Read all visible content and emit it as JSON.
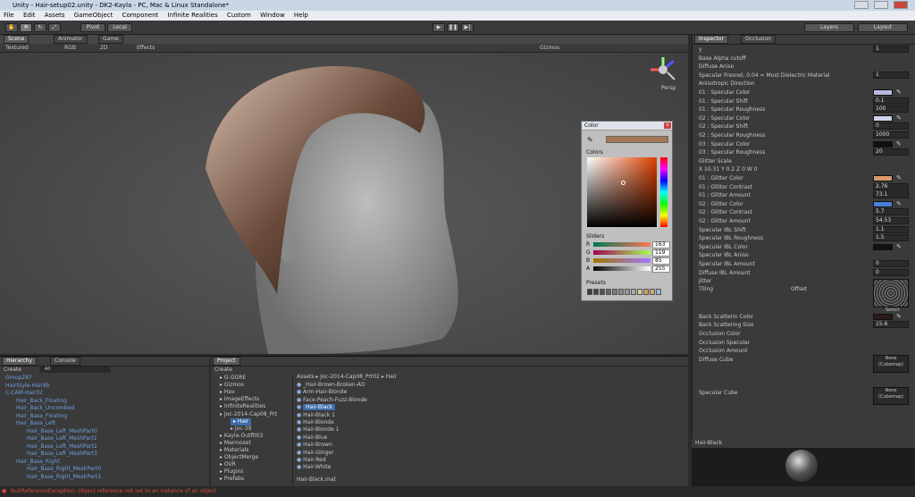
{
  "window": {
    "title": "Unity - Hair-setup02.unity - DK2-Kayla - PC, Mac & Linux Standalone*"
  },
  "menu": [
    "File",
    "Edit",
    "Assets",
    "GameObject",
    "Component",
    "Infinite Realities",
    "Custom",
    "Window",
    "Help"
  ],
  "toolbar": {
    "pivot": "Pivot",
    "local": "Local",
    "layers": "Layers",
    "layout": "Layout"
  },
  "tabs": {
    "scene": "Scene",
    "animator": "Animator",
    "game": "Game",
    "inspector": "Inspector",
    "occlusion": "Occlusion",
    "hierarchy": "Hierarchy",
    "console": "Console",
    "project": "Project"
  },
  "scenebar": {
    "mode": "Textured",
    "render": "RGB",
    "twod": "2D",
    "effects": "Effects",
    "gizmos": "Gizmos",
    "persp": "Persp"
  },
  "color_picker": {
    "title": "Color",
    "colors_label": "Colors",
    "sliders_label": "Sliders",
    "presets_label": "Presets",
    "sliders": [
      {
        "label": "R",
        "value": "163"
      },
      {
        "label": "G",
        "value": "119"
      },
      {
        "label": "B",
        "value": "85"
      },
      {
        "label": "A",
        "value": "255"
      }
    ],
    "current": "#a37755",
    "presets": [
      "#3a3a3a",
      "#444",
      "#555",
      "#666",
      "#777",
      "#888",
      "#999",
      "#aaa",
      "#d9c9a0",
      "#c9a060",
      "#c8b070",
      "#9ab8d8"
    ]
  },
  "inspector": {
    "rows": [
      {
        "label": "y",
        "value": "1"
      },
      {
        "label": "Base Alpha cutoff",
        "value": ""
      },
      {
        "label": "Diffuse Aniso",
        "value": ""
      },
      {
        "label": "Specular Fresnel, 0.04 = Most Dielectric Material",
        "value": "1"
      },
      {
        "label": "Anisotropic Direction",
        "value": ""
      },
      {
        "label": "01 : Specular Color",
        "color": "#b9b9e0"
      },
      {
        "label": "01 : Specular Shift",
        "value": "0.1"
      },
      {
        "label": "01 : Specular Roughness",
        "value": "100"
      },
      {
        "label": "02 : Specular Color",
        "color": "#cfd3e8"
      },
      {
        "label": "02 : Specular Shift",
        "value": "0"
      },
      {
        "label": "02 : Specular Roughness",
        "value": "1000"
      },
      {
        "label": "03 : Specular Color",
        "color": "#111111"
      },
      {
        "label": "03 : Specular Roughness",
        "value": "20"
      },
      {
        "label": "Glitter Scale",
        "value": ""
      },
      {
        "label": "X 10.31     Y 0.2     Z 0     W 0",
        "value": ""
      },
      {
        "label": "01 : Glitter Color",
        "color": "#d99a6a"
      },
      {
        "label": "01 : Glitter Contrast",
        "value": "2.76"
      },
      {
        "label": "01 : Glitter Amount",
        "value": "73.1"
      },
      {
        "label": "02 : Glitter Color",
        "color": "#4a7fd8"
      },
      {
        "label": "02 : Glitter Contrast",
        "value": "5.7"
      },
      {
        "label": "02 : Glitter Amount",
        "value": "54.53"
      },
      {
        "label": "Specular IBL Shift",
        "value": "1.1"
      },
      {
        "label": "Specular IBL Roughness",
        "value": "1.5"
      },
      {
        "label": "Specular IBL Color",
        "color": "#101018"
      },
      {
        "label": "Specular IBL Aniso",
        "value": ""
      },
      {
        "label": "Specular IBL Amount",
        "value": "0"
      },
      {
        "label": "Diffuse IBL Amount",
        "value": "0"
      },
      {
        "label": "Jitter",
        "value": ""
      }
    ],
    "tiling": "Tiling",
    "offset": "Offset",
    "select": "Select",
    "rows2": [
      {
        "label": "Back Scatterin Color",
        "color": "#2a1a18"
      },
      {
        "label": "Back Scattering Size",
        "value": "15.6"
      },
      {
        "label": "Occlusion Color",
        "value": ""
      },
      {
        "label": "Occlusion Specular",
        "value": ""
      },
      {
        "label": "Occlusion Amount",
        "value": ""
      },
      {
        "label": "Diffuse Cube",
        "value": ""
      }
    ],
    "specular_cube": "Specular Cube",
    "none_cubemap": "None (Cubemap)",
    "preview_name": "Hair-Black"
  },
  "hierarchy": {
    "create": "Create",
    "search": "All",
    "items": [
      "Group287",
      "HairStyle-Hair8b",
      "C-CAM-Hair02",
      "Hair_Back_Floating",
      "Hair_Back_Uncombed",
      "Hair_Base_Floating",
      "Hair_Base_Left",
      "Hair_Base_Left_MeshPart0",
      "Hair_Base_Left_MeshPart1",
      "Hair_Base_Left_MeshPart2",
      "Hair_Base_Left_MeshPart3",
      "Hair_Base_Right",
      "Hair_Base_Right_MeshPart0",
      "Hair_Base_Right_MeshPart1"
    ]
  },
  "project": {
    "create": "Create",
    "folders": [
      "G-GORE",
      "Gizmos",
      "Hav",
      "ImageEffects",
      "InfiniteRealities",
      "Joc-2014-Cap08_Prt",
      "Hair",
      "Joc-39",
      "Kayla-Outfit03",
      "Marmoset",
      "Materials",
      "ObjectMerge",
      "OVR",
      "Plugins",
      "Prefabs"
    ],
    "breadcrumb": "Assets ▸ Joc-2014-Cap08_Prt02 ▸ Hair",
    "assets": [
      "_Hair-Brown-Broken-AO",
      "Arm-Hair-Blonde",
      "Face-Peach-Fuzz-Blonde",
      "Hair-Black",
      "Hair-Black 1",
      "Hair-Blonde",
      "Hair-Blonde 1",
      "Hair-Blue",
      "Hair-Brown",
      "Hair-Ginger",
      "Hair-Red",
      "Hair-White"
    ],
    "selected_file": "Hair-Black.mat"
  },
  "status": {
    "error": "NullReferenceException: Object reference not set to an instance of an object"
  }
}
